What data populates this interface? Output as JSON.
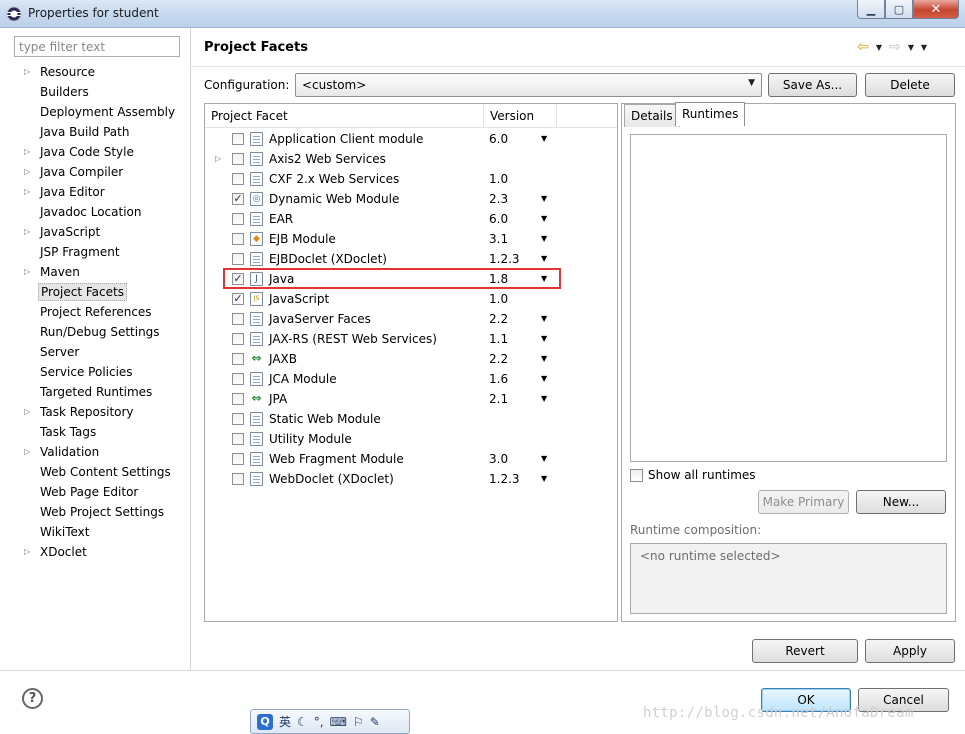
{
  "window": {
    "title": "Properties for student",
    "buttons": [
      "minimize",
      "maximize",
      "close"
    ]
  },
  "filter": {
    "placeholder": "type filter text",
    "value": ""
  },
  "tree": [
    {
      "label": "Resource",
      "expandable": true
    },
    {
      "label": "Builders",
      "expandable": false
    },
    {
      "label": "Deployment Assembly",
      "expandable": false
    },
    {
      "label": "Java Build Path",
      "expandable": false
    },
    {
      "label": "Java Code Style",
      "expandable": true
    },
    {
      "label": "Java Compiler",
      "expandable": true
    },
    {
      "label": "Java Editor",
      "expandable": true
    },
    {
      "label": "Javadoc Location",
      "expandable": false
    },
    {
      "label": "JavaScript",
      "expandable": true
    },
    {
      "label": "JSP Fragment",
      "expandable": false
    },
    {
      "label": "Maven",
      "expandable": true
    },
    {
      "label": "Project Facets",
      "expandable": false,
      "selected": true
    },
    {
      "label": "Project References",
      "expandable": false
    },
    {
      "label": "Run/Debug Settings",
      "expandable": false
    },
    {
      "label": "Server",
      "expandable": false
    },
    {
      "label": "Service Policies",
      "expandable": false
    },
    {
      "label": "Targeted Runtimes",
      "expandable": false
    },
    {
      "label": "Task Repository",
      "expandable": true
    },
    {
      "label": "Task Tags",
      "expandable": false
    },
    {
      "label": "Validation",
      "expandable": true
    },
    {
      "label": "Web Content Settings",
      "expandable": false
    },
    {
      "label": "Web Page Editor",
      "expandable": false
    },
    {
      "label": "Web Project Settings",
      "expandable": false
    },
    {
      "label": "WikiText",
      "expandable": false
    },
    {
      "label": "XDoclet",
      "expandable": true
    }
  ],
  "page": {
    "title": "Project Facets"
  },
  "config": {
    "label": "Configuration:",
    "value": "<custom>",
    "save_as": "Save As...",
    "delete": "Delete"
  },
  "table": {
    "col_facet": "Project Facet",
    "col_version": "Version",
    "rows": [
      {
        "name": "Application Client module",
        "version": "6.0",
        "checked": false,
        "dropdown": true,
        "icon": "page-icon"
      },
      {
        "name": "Axis2 Web Services",
        "version": "",
        "checked": false,
        "dropdown": false,
        "expandable": true,
        "icon": "page-icon"
      },
      {
        "name": "CXF 2.x Web Services",
        "version": "1.0",
        "checked": false,
        "dropdown": false,
        "icon": "page-icon"
      },
      {
        "name": "Dynamic Web Module",
        "version": "2.3",
        "checked": true,
        "dropdown": true,
        "icon": "web-module-icon"
      },
      {
        "name": "EAR",
        "version": "6.0",
        "checked": false,
        "dropdown": true,
        "icon": "page-icon"
      },
      {
        "name": "EJB Module",
        "version": "3.1",
        "checked": false,
        "dropdown": true,
        "icon": "ejb-icon"
      },
      {
        "name": "EJBDoclet (XDoclet)",
        "version": "1.2.3",
        "checked": false,
        "dropdown": true,
        "icon": "page-icon"
      },
      {
        "name": "Java",
        "version": "1.8",
        "checked": true,
        "dropdown": true,
        "icon": "java-icon",
        "highlighted": true
      },
      {
        "name": "JavaScript",
        "version": "1.0",
        "checked": true,
        "dropdown": false,
        "icon": "javascript-icon"
      },
      {
        "name": "JavaServer Faces",
        "version": "2.2",
        "checked": false,
        "dropdown": true,
        "icon": "page-icon"
      },
      {
        "name": "JAX-RS (REST Web Services)",
        "version": "1.1",
        "checked": false,
        "dropdown": true,
        "icon": "page-icon"
      },
      {
        "name": "JAXB",
        "version": "2.2",
        "checked": false,
        "dropdown": true,
        "icon": "arrows-icon"
      },
      {
        "name": "JCA Module",
        "version": "1.6",
        "checked": false,
        "dropdown": true,
        "icon": "page-icon"
      },
      {
        "name": "JPA",
        "version": "2.1",
        "checked": false,
        "dropdown": true,
        "icon": "arrows-icon"
      },
      {
        "name": "Static Web Module",
        "version": "",
        "checked": false,
        "dropdown": false,
        "icon": "page-icon"
      },
      {
        "name": "Utility Module",
        "version": "",
        "checked": false,
        "dropdown": false,
        "icon": "page-icon"
      },
      {
        "name": "Web Fragment Module",
        "version": "3.0",
        "checked": false,
        "dropdown": true,
        "icon": "page-icon"
      },
      {
        "name": "WebDoclet (XDoclet)",
        "version": "1.2.3",
        "checked": false,
        "dropdown": true,
        "icon": "page-icon"
      }
    ]
  },
  "tabs": {
    "details": "Details",
    "runtimes": "Runtimes",
    "active": "Runtimes"
  },
  "runtimes": {
    "show_all": "Show all runtimes",
    "show_all_checked": false,
    "make_primary": "Make Primary",
    "new": "New...",
    "composition_label": "Runtime composition:",
    "composition_value": "<no runtime selected>"
  },
  "buttons": {
    "revert": "Revert",
    "apply": "Apply",
    "ok": "OK",
    "cancel": "Cancel"
  },
  "ime": {
    "logo": "Q",
    "lang": "英"
  },
  "watermark": "http://blog.csdn.net/AnofaDream",
  "colors": {
    "highlight": "#e53333",
    "titlebar": "#c5d8ee",
    "default_button": "#bee6fd"
  }
}
